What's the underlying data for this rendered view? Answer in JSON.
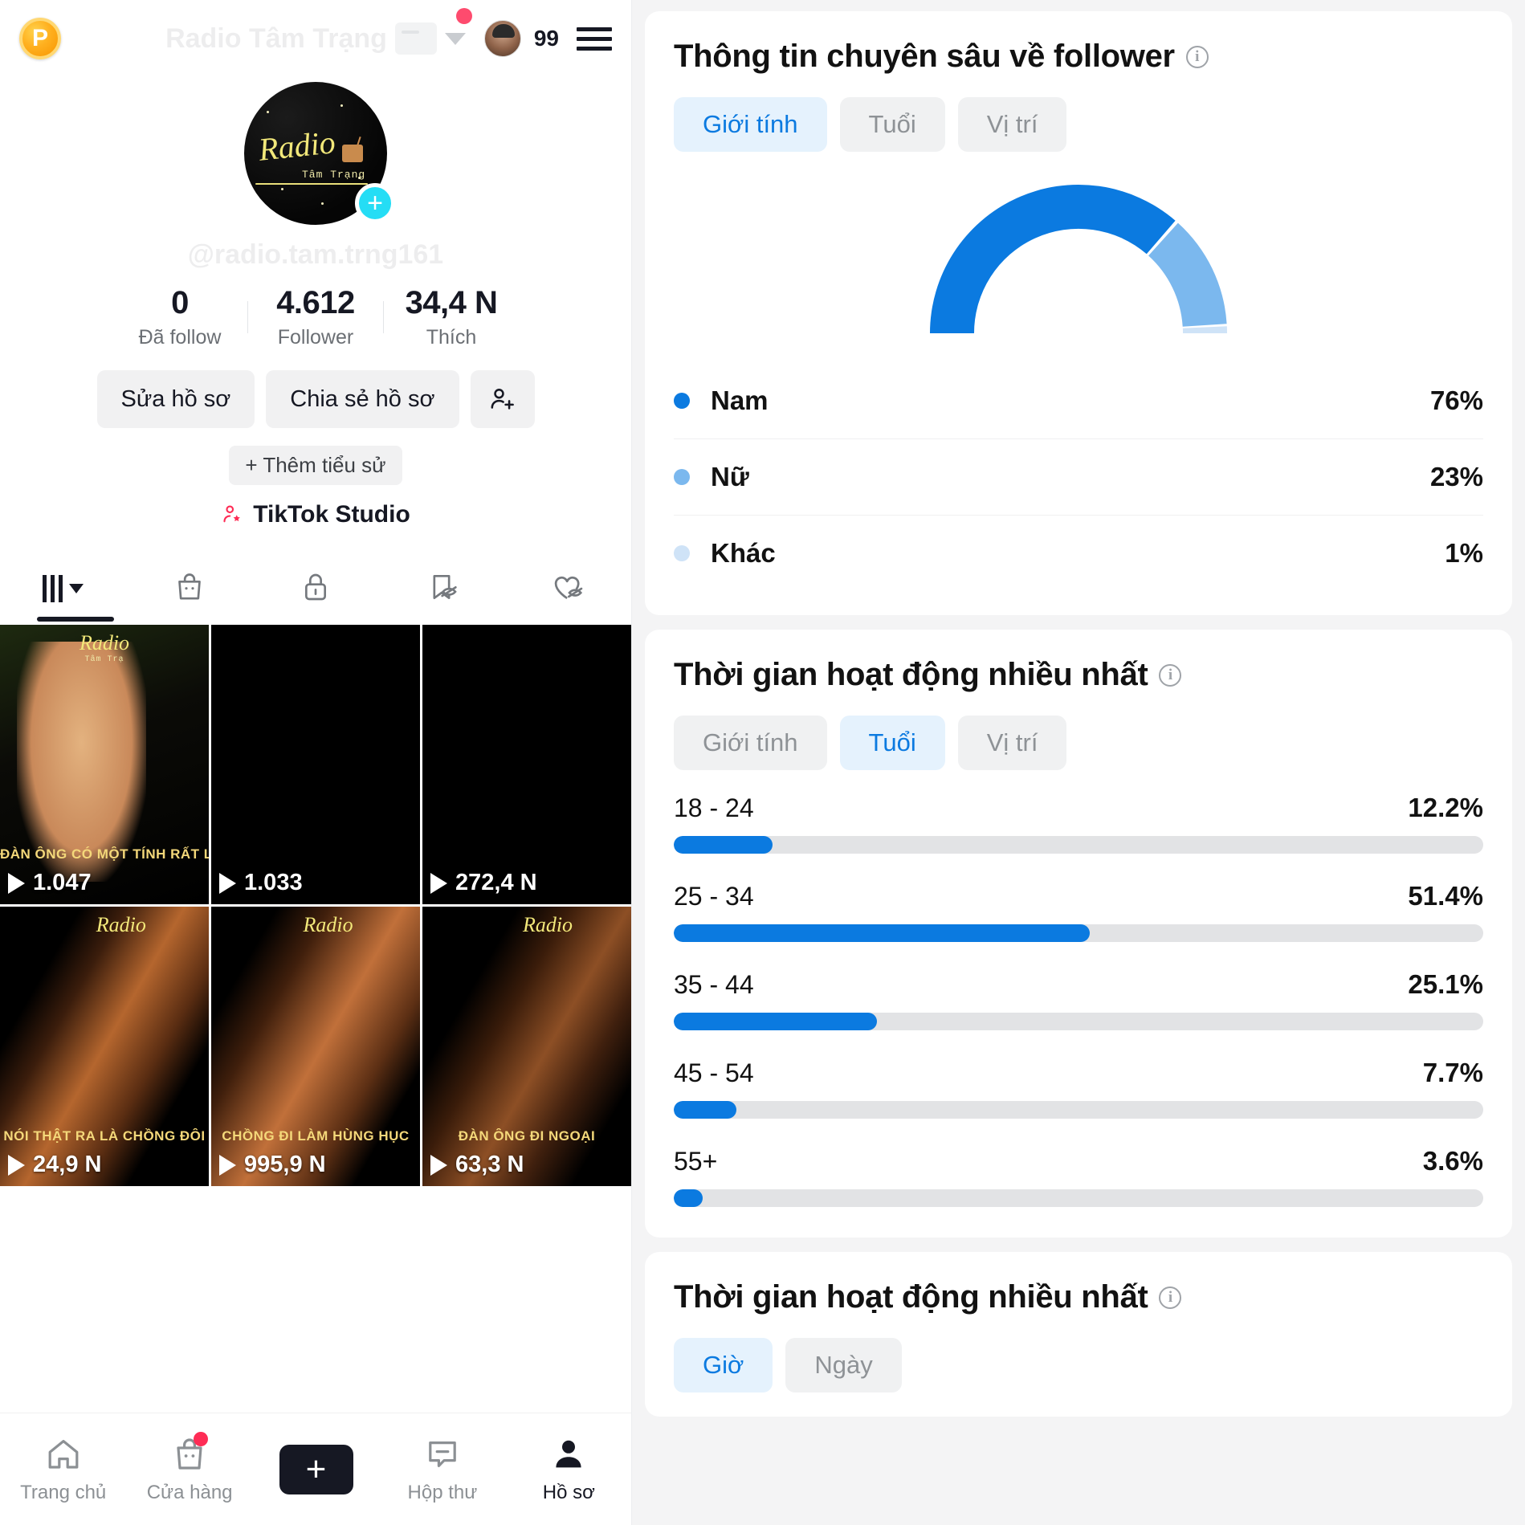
{
  "left": {
    "topbar": {
      "coin_label": "P",
      "title": "Radio Tâm Trạng",
      "notification_count": "99",
      "radio_icon": "radio-icon",
      "chevron_icon": "chevron-down-icon",
      "menu_icon": "hamburger-menu-icon"
    },
    "profile": {
      "avatar_script": "Radio",
      "avatar_sub": "Tâm Trạng",
      "handle": "@radio.tam.trng161",
      "add_story_icon": "plus-badge-icon"
    },
    "stats": [
      {
        "num": "0",
        "label": "Đã follow"
      },
      {
        "num": "4.612",
        "label": "Follower"
      },
      {
        "num": "34,4 N",
        "label": "Thích"
      }
    ],
    "actions": {
      "edit_profile": "Sửa hồ sơ",
      "share_profile": "Chia sẻ hồ sơ",
      "add_friend_icon": "add-person-icon"
    },
    "bio_chip": "+ Thêm tiểu sử",
    "studio": "TikTok Studio",
    "tabs": [
      {
        "icon": "grid-posts-icon",
        "active": true
      },
      {
        "icon": "shopping-bag-icon",
        "active": false
      },
      {
        "icon": "lock-icon",
        "active": false
      },
      {
        "icon": "bookmark-off-icon",
        "active": false
      },
      {
        "icon": "heart-off-icon",
        "active": false
      }
    ],
    "videos": [
      {
        "views": "1.047",
        "caption": "ĐÀN ÔNG CÓ MỘT TÍNH RẤT LẠ",
        "logo": "Radio",
        "logo_sub": "Tâm Trạ"
      },
      {
        "views": "1.033",
        "caption": "",
        "logo": "",
        "logo_sub": ""
      },
      {
        "views": "272,4 N",
        "caption": "",
        "logo": "",
        "logo_sub": ""
      },
      {
        "views": "24,9 N",
        "caption": "NÓI THẬT RA LÀ CHỒNG ĐÔI",
        "logo": "Radio",
        "logo_sub": ""
      },
      {
        "views": "995,9 N",
        "caption": "CHỒNG ĐI LÀM HÙNG HỤC",
        "logo": "Radio",
        "logo_sub": ""
      },
      {
        "views": "63,3 N",
        "caption": "ĐÀN ÔNG ĐI NGOẠI",
        "logo": "Radio",
        "logo_sub": ""
      }
    ],
    "bottom_nav": [
      {
        "label": "Trang chủ",
        "icon": "home-icon",
        "active": true
      },
      {
        "label": "Cửa hàng",
        "icon": "shop-bag-icon",
        "active": false,
        "badge": true
      },
      {
        "label": "",
        "icon": "create-plus-icon",
        "active": false
      },
      {
        "label": "Hộp thư",
        "icon": "inbox-icon",
        "active": false
      },
      {
        "label": "Hồ sơ",
        "icon": "person-icon",
        "active": true
      }
    ]
  },
  "right": {
    "follower_insights": {
      "title": "Thông tin chuyên sâu về follower",
      "info_icon": "info-icon",
      "chips": [
        {
          "label": "Giới tính",
          "active": true
        },
        {
          "label": "Tuổi",
          "active": false
        },
        {
          "label": "Vị trí",
          "active": false
        }
      ]
    },
    "most_active_age": {
      "title": "Thời gian hoạt động nhiều nhất",
      "info_icon": "info-icon",
      "chips": [
        {
          "label": "Giới tính",
          "active": false
        },
        {
          "label": "Tuổi",
          "active": true
        },
        {
          "label": "Vị trí",
          "active": false
        }
      ]
    },
    "most_active_time": {
      "title": "Thời gian hoạt động nhiều nhất",
      "info_icon": "info-icon",
      "chips": [
        {
          "label": "Giờ",
          "active": true
        },
        {
          "label": "Ngày",
          "active": false
        }
      ]
    }
  },
  "chart_data": [
    {
      "type": "pie",
      "title": "Thông tin chuyên sâu về follower",
      "subtitle": "Giới tính",
      "shape": "half-donut-gauge",
      "labels": [
        "Nam",
        "Nữ",
        "Khác"
      ],
      "values": [
        76,
        23,
        1
      ],
      "value_labels": [
        "76%",
        "23%",
        "1%"
      ],
      "colors": [
        "#0b7ae0",
        "#7bb8ee",
        "#cfe3f7"
      ],
      "legend": "below"
    },
    {
      "type": "bar",
      "orientation": "horizontal",
      "title": "Thời gian hoạt động nhiều nhất",
      "subtitle": "Tuổi",
      "categories": [
        "18 - 24",
        "25 - 34",
        "35 - 44",
        "45 - 54",
        "55+"
      ],
      "values": [
        12.2,
        51.4,
        25.1,
        7.7,
        3.6
      ],
      "value_labels": [
        "12.2%",
        "51.4%",
        "25.1%",
        "7.7%",
        "3.6%"
      ],
      "xlabel": "",
      "ylabel": "",
      "xlim": [
        0,
        100
      ],
      "grid": false,
      "bar_color": "#0b7ae0",
      "track_color": "#e2e3e5"
    }
  ]
}
